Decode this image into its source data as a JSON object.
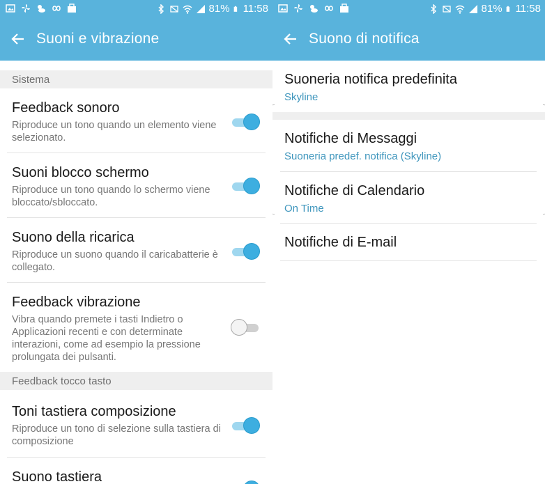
{
  "status_bar": {
    "battery": "81%",
    "time": "11:58"
  },
  "left": {
    "title": "Suoni e vibrazione",
    "sections": [
      {
        "header": "Sistema"
      },
      {
        "header": "Feedback tocco tasto"
      }
    ],
    "items": [
      {
        "title": "Feedback sonoro",
        "desc": "Riproduce un tono quando un elemento viene selezionato.",
        "on": true
      },
      {
        "title": "Suoni blocco schermo",
        "desc": "Riproduce un tono quando lo schermo viene bloccato/sbloccato.",
        "on": true
      },
      {
        "title": "Suono della ricarica",
        "desc": "Riproduce un suono quando il caricabatterie è collegato.",
        "on": true
      },
      {
        "title": "Feedback vibrazione",
        "desc": "Vibra quando premete i tasti Indietro o Applicazioni recenti e con determinate interazioni, come ad esempio la pressione prolungata dei pulsanti.",
        "on": false
      },
      {
        "title": "Toni tastiera composizione",
        "desc": "Riproduce un tono di selezione sulla tastiera di composizione",
        "on": true
      },
      {
        "title": "Suono tastiera",
        "on": true
      }
    ]
  },
  "right": {
    "title": "Suono di notifica",
    "items": [
      {
        "title": "Suoneria notifica predefinita",
        "sub": "Skyline"
      },
      {
        "title": "Notifiche di Messaggi",
        "sub": "Suoneria predef. notifica (Skyline)"
      },
      {
        "title": "Notifiche di Calendario",
        "sub": "On Time"
      },
      {
        "title": "Notifiche di E-mail"
      }
    ]
  },
  "colors": {
    "accent": "#59b3dc",
    "toggle_on": "#3daee0",
    "subtitle": "#3f96bd"
  }
}
